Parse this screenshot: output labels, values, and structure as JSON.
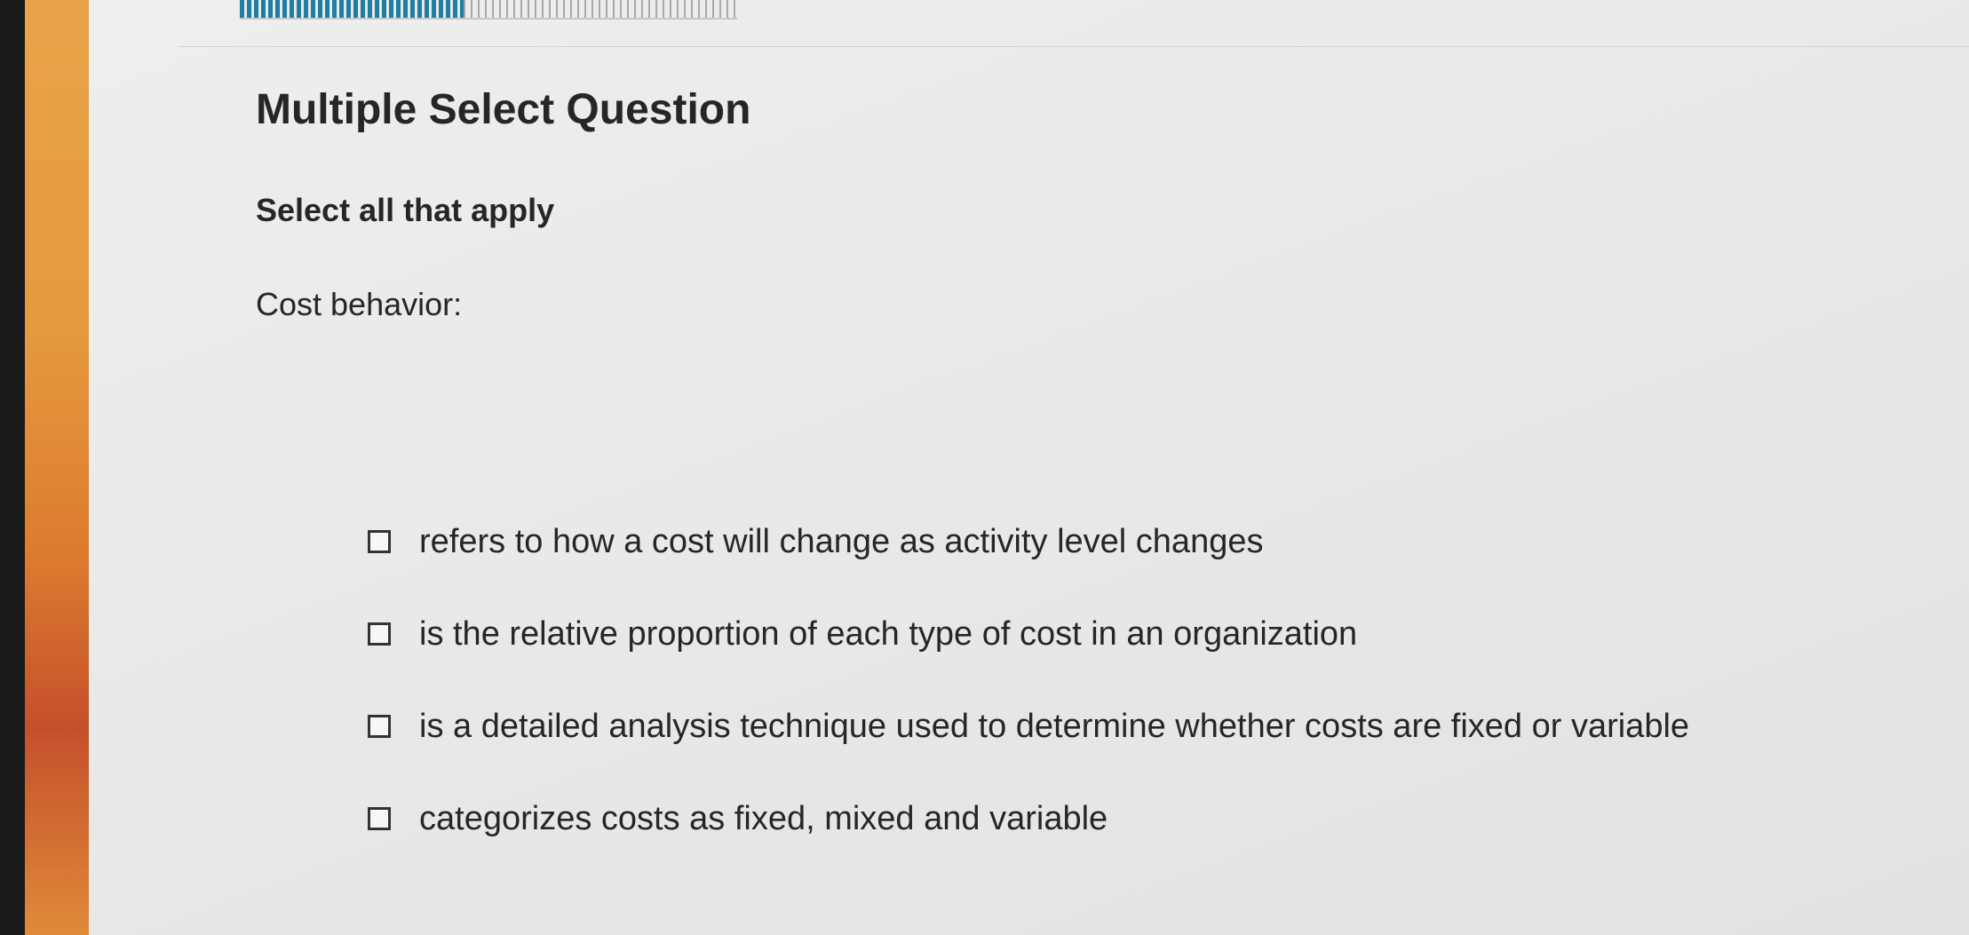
{
  "colors": {
    "progress_fill": "#1f7ea3",
    "side_strip": "#e69a3e",
    "background": "#e9e9e7",
    "text": "#262626"
  },
  "progress": {
    "fraction_complete": 0.45
  },
  "question": {
    "type_label": "Multiple Select Question",
    "instruction": "Select all that apply",
    "prompt": "Cost behavior:",
    "options": [
      {
        "label": "refers to how a cost will change as activity level changes",
        "checked": false
      },
      {
        "label": "is the relative proportion of each type of cost in an organization",
        "checked": false
      },
      {
        "label": "is a detailed analysis technique used to determine whether costs are fixed or variable",
        "checked": false
      },
      {
        "label": "categorizes costs as fixed, mixed and variable",
        "checked": false
      }
    ]
  }
}
